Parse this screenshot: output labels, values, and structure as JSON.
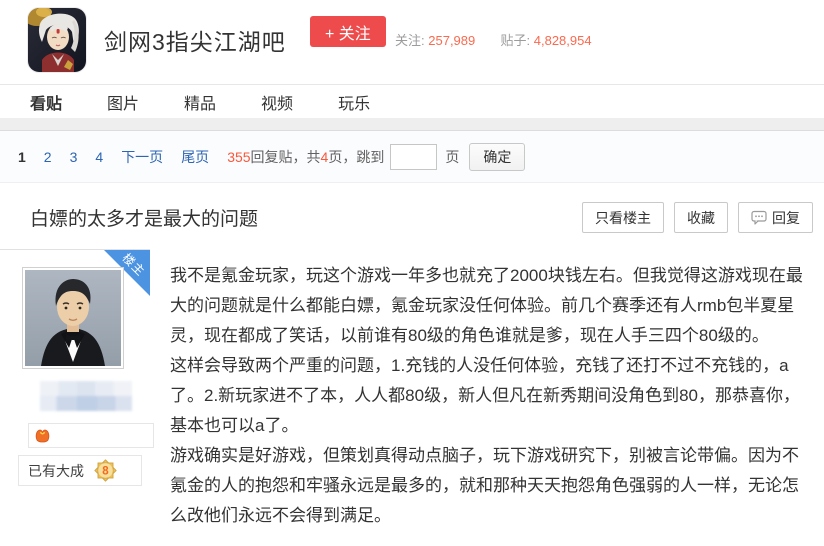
{
  "forum": {
    "title": "剑网3指尖江湖吧",
    "follow_label": "+ 关注",
    "followers_label": "关注:",
    "followers_count": "257,989",
    "posts_label": "贴子:",
    "posts_count": "4,828,954"
  },
  "nav": {
    "tabs": [
      "看贴",
      "图片",
      "精品",
      "视频",
      "玩乐"
    ]
  },
  "pagination": {
    "current": "1",
    "links": [
      "2",
      "3",
      "4"
    ],
    "next_label": "下一页",
    "last_label": "尾页",
    "reply_count": "355",
    "reply_text": "回复贴，共",
    "total_pages": "4",
    "pages_text": "页，跳到",
    "jump_value": "",
    "unit_label": "页",
    "confirm_label": "确定"
  },
  "thread": {
    "title": "白嫖的太多才是最大的问题",
    "view_author_label": "只看楼主",
    "favorite_label": "收藏",
    "reply_label": "回复"
  },
  "post": {
    "ribbon_label": "楼主",
    "level_name": "已有大成",
    "level_number": "8",
    "paragraphs": [
      "我不是氪金玩家，玩这个游戏一年多也就充了2000块钱左右。但我觉得这游戏现在最大的问题就是什么都能白嫖，氪金玩家没任何体验。前几个赛季还有人rmb包半夏星灵，现在都成了笑话，以前谁有80级的角色谁就是爹，现在人手三四个80级的。",
      "这样会导致两个严重的问题，1.充钱的人没任何体验，充钱了还打不过不充钱的，a了。2.新玩家进不了本，人人都80级，新人但凡在新秀期间没角色到80，那恭喜你，基本也可以a了。",
      "游戏确实是好游戏，但策划真得动点脑子，玩下游戏研究下，别被言论带偏。因为不氪金的人的抱怨和牢骚永远是最多的，就和那种天天抱怨角色强弱的人一样，无论怎么改他们永远不会得到满足。"
    ]
  },
  "icons": {
    "reply": "speech-bubble",
    "medal": "orange-medal",
    "level_badge": "gold-star-badge"
  },
  "colors": {
    "follow_red": "#ee4c4c",
    "stat_orange": "#fa6a4f",
    "link_blue": "#2d64b3",
    "ribbon_blue": "#4c94e2",
    "count_red": "#f55a3d",
    "text_dark": "#333333"
  }
}
